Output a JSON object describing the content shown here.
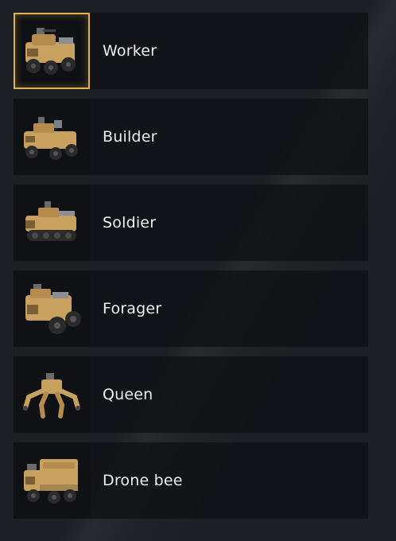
{
  "units": [
    {
      "name": "Worker",
      "icon": "armored-truck-icon",
      "selected": true
    },
    {
      "name": "Builder",
      "icon": "armored-truck-icon",
      "selected": false
    },
    {
      "name": "Soldier",
      "icon": "tracked-vehicle-icon",
      "selected": false
    },
    {
      "name": "Forager",
      "icon": "armored-truck-icon",
      "selected": false
    },
    {
      "name": "Queen",
      "icon": "spider-walker-icon",
      "selected": false
    },
    {
      "name": "Drone bee",
      "icon": "cargo-truck-icon",
      "selected": false
    }
  ],
  "colors": {
    "background": "#1c1f24",
    "card": "#0f1114",
    "selected_border": "#e3b34a",
    "vehicle_body": "#c9a15e",
    "text": "#eef0f2"
  }
}
